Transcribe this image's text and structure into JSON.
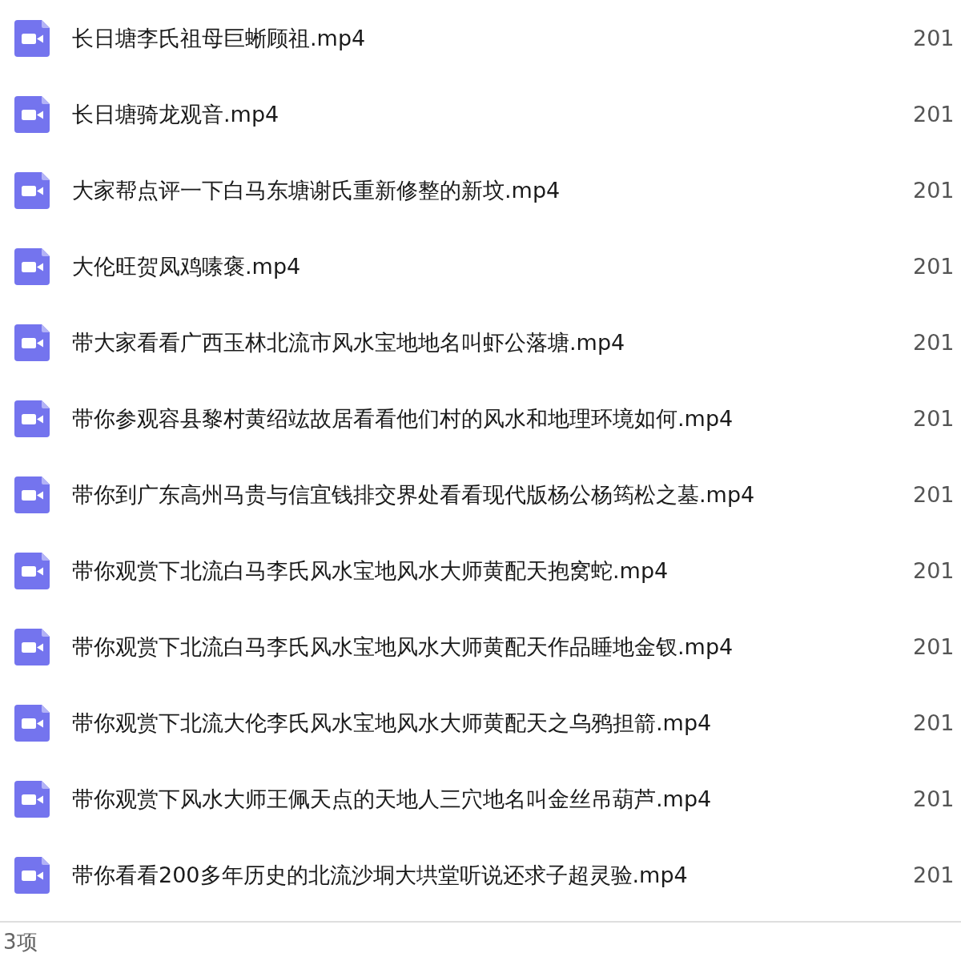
{
  "files": [
    {
      "name": "长日塘李氏祖母巨蜥顾祖.mp4",
      "date": "201"
    },
    {
      "name": "长日塘骑龙观音.mp4",
      "date": "201"
    },
    {
      "name": "大家帮点评一下白马东塘谢氏重新修整的新坟.mp4",
      "date": "201"
    },
    {
      "name": "大伦旺贺凤鸡嗉褒.mp4",
      "date": "201"
    },
    {
      "name": "带大家看看广西玉林北流市风水宝地地名叫虾公落塘.mp4",
      "date": "201"
    },
    {
      "name": "带你参观容县黎村黄绍竑故居看看他们村的风水和地理环境如何.mp4",
      "date": "201"
    },
    {
      "name": "带你到广东高州马贵与信宜钱排交界处看看现代版杨公杨筠松之墓.mp4",
      "date": "201"
    },
    {
      "name": "带你观赏下北流白马李氏风水宝地风水大师黄配天抱窝蛇.mp4",
      "date": "201"
    },
    {
      "name": "带你观赏下北流白马李氏风水宝地风水大师黄配天作品睡地金钗.mp4",
      "date": "201"
    },
    {
      "name": "带你观赏下北流大伦李氏风水宝地风水大师黄配天之乌鸦担箭.mp4",
      "date": "201"
    },
    {
      "name": "带你观赏下风水大师王佩天点的天地人三穴地名叫金丝吊葫芦.mp4",
      "date": "201"
    },
    {
      "name": "带你看看200多年历史的北流沙垌大垬堂听说还求子超灵验.mp4",
      "date": "201"
    }
  ],
  "status_bar": {
    "count": "3项"
  }
}
